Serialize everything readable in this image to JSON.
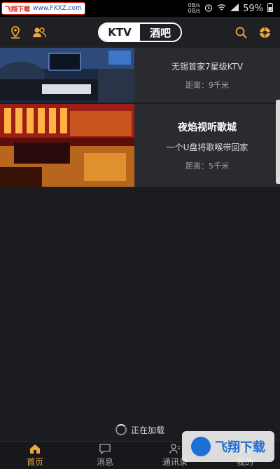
{
  "statusbar": {
    "watermark_left_red": "飞翔下载",
    "watermark_left_blue": "www.FXXZ.com",
    "speed_top": "0B/s",
    "speed_bottom": "0B/s",
    "battery": "59%"
  },
  "appbar": {
    "tabs": [
      {
        "label": "KTV",
        "active": true
      },
      {
        "label": "酒吧",
        "active": false
      }
    ]
  },
  "venues": [
    {
      "name": "",
      "slogan": "无锡首家7星级KTV",
      "distance": "距离：9千米"
    },
    {
      "name": "夜焰视听歌城",
      "slogan": "一个U盘将歌喉带回家",
      "distance": "距离：5千米"
    }
  ],
  "loading_text": "正在加载",
  "tabbar": {
    "items": [
      {
        "label": "首页",
        "icon": "home-icon",
        "active": true
      },
      {
        "label": "消息",
        "icon": "message-icon",
        "active": false
      },
      {
        "label": "通讯录",
        "icon": "contacts-icon",
        "active": false
      },
      {
        "label": "我的",
        "icon": "profile-icon",
        "active": false
      }
    ]
  },
  "overlay_watermark": "飞翔下载",
  "colors": {
    "accent": "#f0a63c",
    "background": "#1b1c20",
    "card": "#2a2b30"
  }
}
